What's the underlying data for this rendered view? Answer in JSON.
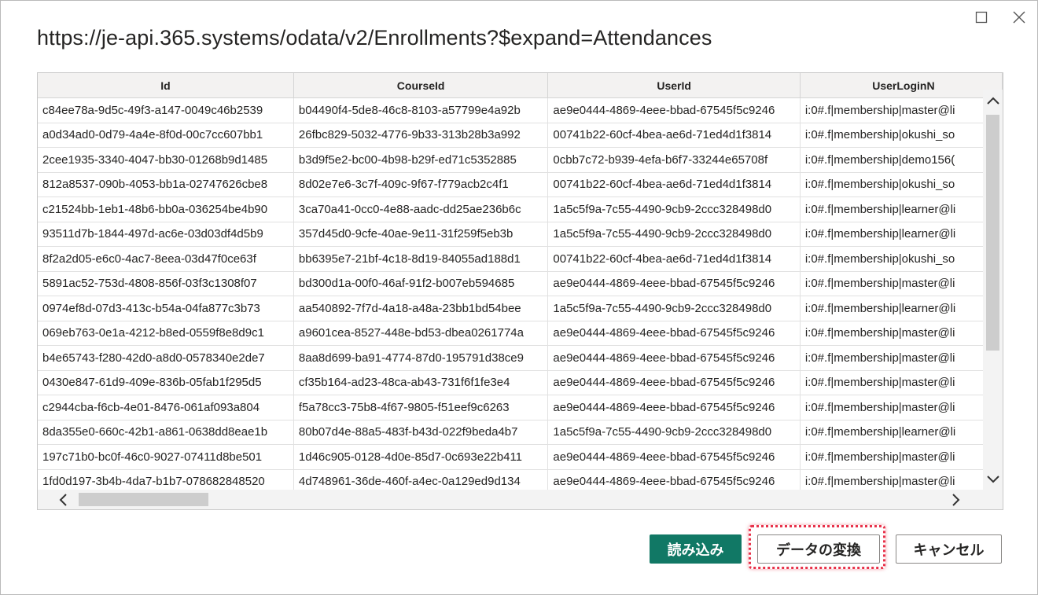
{
  "dialog": {
    "title": "https://je-api.365.systems/odata/v2/Enrollments?$expand=Attendances",
    "maximize_icon": "maximize-icon",
    "close_icon": "close-icon"
  },
  "grid": {
    "columns": [
      "Id",
      "CourseId",
      "UserId",
      "UserLoginN"
    ],
    "rows": [
      [
        "c84ee78a-9d5c-49f3-a147-0049c46b2539",
        "b04490f4-5de8-46c8-8103-a57799e4a92b",
        "ae9e0444-4869-4eee-bbad-67545f5c9246",
        "i:0#.f|membership|master@li"
      ],
      [
        "a0d34ad0-0d79-4a4e-8f0d-00c7cc607bb1",
        "26fbc829-5032-4776-9b33-313b28b3a992",
        "00741b22-60cf-4bea-ae6d-71ed4d1f3814",
        "i:0#.f|membership|okushi_so"
      ],
      [
        "2cee1935-3340-4047-bb30-01268b9d1485",
        "b3d9f5e2-bc00-4b98-b29f-ed71c5352885",
        "0cbb7c72-b939-4efa-b6f7-33244e65708f",
        "i:0#.f|membership|demo156("
      ],
      [
        "812a8537-090b-4053-bb1a-02747626cbe8",
        "8d02e7e6-3c7f-409c-9f67-f779acb2c4f1",
        "00741b22-60cf-4bea-ae6d-71ed4d1f3814",
        "i:0#.f|membership|okushi_so"
      ],
      [
        "c21524bb-1eb1-48b6-bb0a-036254be4b90",
        "3ca70a41-0cc0-4e88-aadc-dd25ae236b6c",
        "1a5c5f9a-7c55-4490-9cb9-2ccc328498d0",
        "i:0#.f|membership|learner@li"
      ],
      [
        "93511d7b-1844-497d-ac6e-03d03df4d5b9",
        "357d45d0-9cfe-40ae-9e11-31f259f5eb3b",
        "1a5c5f9a-7c55-4490-9cb9-2ccc328498d0",
        "i:0#.f|membership|learner@li"
      ],
      [
        "8f2a2d05-e6c0-4ac7-8eea-03d47f0ce63f",
        "bb6395e7-21bf-4c18-8d19-84055ad188d1",
        "00741b22-60cf-4bea-ae6d-71ed4d1f3814",
        "i:0#.f|membership|okushi_so"
      ],
      [
        "5891ac52-753d-4808-856f-03f3c1308f07",
        "bd300d1a-00f0-46af-91f2-b007eb594685",
        "ae9e0444-4869-4eee-bbad-67545f5c9246",
        "i:0#.f|membership|master@li"
      ],
      [
        "0974ef8d-07d3-413c-b54a-04fa877c3b73",
        "aa540892-7f7d-4a18-a48a-23bb1bd54bee",
        "1a5c5f9a-7c55-4490-9cb9-2ccc328498d0",
        "i:0#.f|membership|learner@li"
      ],
      [
        "069eb763-0e1a-4212-b8ed-0559f8e8d9c1",
        "a9601cea-8527-448e-bd53-dbea0261774a",
        "ae9e0444-4869-4eee-bbad-67545f5c9246",
        "i:0#.f|membership|master@li"
      ],
      [
        "b4e65743-f280-42d0-a8d0-0578340e2de7",
        "8aa8d699-ba91-4774-87d0-195791d38ce9",
        "ae9e0444-4869-4eee-bbad-67545f5c9246",
        "i:0#.f|membership|master@li"
      ],
      [
        "0430e847-61d9-409e-836b-05fab1f295d5",
        "cf35b164-ad23-48ca-ab43-731f6f1fe3e4",
        "ae9e0444-4869-4eee-bbad-67545f5c9246",
        "i:0#.f|membership|master@li"
      ],
      [
        "c2944cba-f6cb-4e01-8476-061af093a804",
        "f5a78cc3-75b8-4f67-9805-f51eef9c6263",
        "ae9e0444-4869-4eee-bbad-67545f5c9246",
        "i:0#.f|membership|master@li"
      ],
      [
        "8da355e0-660c-42b1-a861-0638dd8eae1b",
        "80b07d4e-88a5-483f-b43d-022f9beda4b7",
        "1a5c5f9a-7c55-4490-9cb9-2ccc328498d0",
        "i:0#.f|membership|learner@li"
      ],
      [
        "197c71b0-bc0f-46c0-9027-07411d8be501",
        "1d46c905-0128-4d0e-85d7-0c693e22b411",
        "ae9e0444-4869-4eee-bbad-67545f5c9246",
        "i:0#.f|membership|master@li"
      ],
      [
        "1fd0d197-3b4b-4da7-b1b7-078682848520",
        "4d748961-36de-460f-a4ec-0a129ed9d134",
        "ae9e0444-4869-4eee-bbad-67545f5c9246",
        "i:0#.f|membership|master@li"
      ]
    ]
  },
  "buttons": {
    "load_label": "読み込み",
    "transform_label": "データの変換",
    "cancel_label": "キャンセル"
  },
  "colors": {
    "primary": "#117865",
    "highlight": "#e8324a"
  }
}
